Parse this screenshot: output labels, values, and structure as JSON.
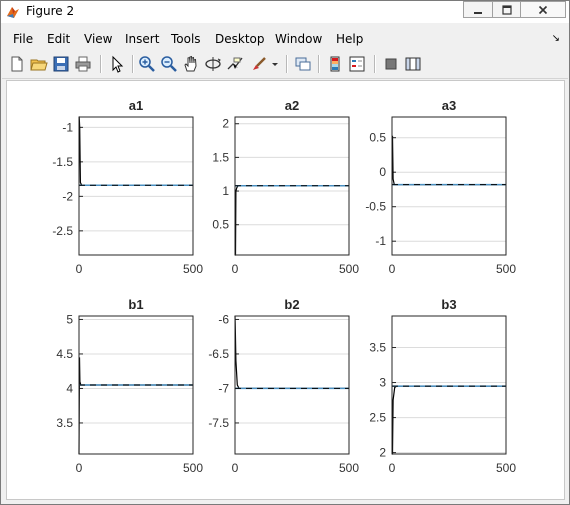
{
  "window": {
    "title": "Figure 2",
    "icon": "matlab-logo-icon",
    "controls": [
      "minimize-icon",
      "maximize-icon",
      "close-icon"
    ]
  },
  "menubar": {
    "items": [
      {
        "label": "File"
      },
      {
        "label": "Edit"
      },
      {
        "label": "View"
      },
      {
        "label": "Insert"
      },
      {
        "label": "Tools"
      },
      {
        "label": "Desktop"
      },
      {
        "label": "Window"
      },
      {
        "label": "Help"
      }
    ]
  },
  "toolbar": {
    "buttons": [
      "new-figure-icon",
      "open-file-icon",
      "save-icon",
      "print-icon",
      "edit-plot-icon",
      "zoom-in-icon",
      "zoom-out-icon",
      "pan-icon",
      "rotate-3d-icon",
      "data-cursor-icon",
      "brush-icon",
      "brush-dropdown-icon",
      "link-plot-icon",
      "insert-colorbar-icon",
      "insert-legend-icon",
      "hide-plot-tools-icon",
      "show-plot-tools-icon"
    ]
  },
  "colors": {
    "trace": "#000000",
    "reference": "#4a90c2",
    "grid": "#dcdcdc"
  },
  "chart_data": [
    {
      "type": "line",
      "title": "a1",
      "xlim": [
        0,
        500
      ],
      "ylim": [
        -2.85,
        -0.85
      ],
      "xticks": [
        0,
        500
      ],
      "yticks": [
        -1,
        -1.5,
        -2,
        -2.5
      ],
      "grid": "y",
      "series": [
        {
          "role": "estimate",
          "x": [
            0,
            1,
            3,
            6,
            12,
            500
          ],
          "y": [
            -0.85,
            -0.85,
            -1.0,
            -1.8,
            -1.84,
            -1.84
          ]
        },
        {
          "role": "true-value",
          "style": "dashed",
          "x": [
            0,
            500
          ],
          "y": [
            -1.84,
            -1.84
          ]
        }
      ]
    },
    {
      "type": "line",
      "title": "a2",
      "xlim": [
        0,
        500
      ],
      "ylim": [
        0.05,
        2.1
      ],
      "xticks": [
        0,
        500
      ],
      "yticks": [
        2,
        1.5,
        1,
        0.5
      ],
      "grid": "y",
      "series": [
        {
          "role": "estimate",
          "x": [
            0,
            2,
            4,
            8,
            14,
            500
          ],
          "y": [
            0.05,
            0.05,
            1.0,
            1.05,
            1.08,
            1.08
          ]
        },
        {
          "role": "true-value",
          "style": "dashed",
          "x": [
            0,
            500
          ],
          "y": [
            1.08,
            1.08
          ]
        }
      ]
    },
    {
      "type": "line",
      "title": "a3",
      "xlim": [
        0,
        500
      ],
      "ylim": [
        -1.2,
        0.8
      ],
      "xticks": [
        0,
        500
      ],
      "yticks": [
        0.5,
        0,
        -0.5,
        -1
      ],
      "grid": "y",
      "series": [
        {
          "role": "estimate",
          "x": [
            0,
            2,
            5,
            10,
            500
          ],
          "y": [
            0.52,
            0.52,
            -0.1,
            -0.18,
            -0.18
          ]
        },
        {
          "role": "true-value",
          "style": "dashed",
          "x": [
            0,
            500
          ],
          "y": [
            -0.18,
            -0.18
          ]
        }
      ]
    },
    {
      "type": "line",
      "title": "b1",
      "xlim": [
        0,
        500
      ],
      "ylim": [
        3.05,
        5.05
      ],
      "xticks": [
        0,
        500
      ],
      "yticks": [
        5,
        4.5,
        4,
        3.5
      ],
      "grid": "y",
      "series": [
        {
          "role": "estimate",
          "x": [
            0,
            2,
            4,
            8,
            500
          ],
          "y": [
            3.05,
            4.45,
            4.1,
            4.05,
            4.05
          ]
        },
        {
          "role": "true-value",
          "style": "dashed",
          "x": [
            0,
            500
          ],
          "y": [
            4.05,
            4.05
          ]
        }
      ]
    },
    {
      "type": "line",
      "title": "b2",
      "xlim": [
        0,
        500
      ],
      "ylim": [
        -7.95,
        -5.95
      ],
      "xticks": [
        0,
        500
      ],
      "yticks": [
        -6,
        -6.5,
        -7,
        -7.5
      ],
      "grid": "y",
      "series": [
        {
          "role": "estimate",
          "x": [
            0,
            1,
            4,
            10,
            18,
            500
          ],
          "y": [
            -5.95,
            -6.05,
            -6.6,
            -6.95,
            -7.0,
            -7.0
          ]
        },
        {
          "role": "true-value",
          "style": "dashed",
          "x": [
            0,
            500
          ],
          "y": [
            -7.0,
            -7.0
          ]
        }
      ]
    },
    {
      "type": "line",
      "title": "b3",
      "xlim": [
        0,
        500
      ],
      "ylim": [
        1.98,
        3.95
      ],
      "xticks": [
        0,
        500
      ],
      "yticks": [
        3.5,
        3,
        2.5,
        2
      ],
      "grid": "y",
      "series": [
        {
          "role": "estimate",
          "x": [
            0,
            2,
            5,
            12,
            20,
            500
          ],
          "y": [
            1.98,
            1.98,
            2.75,
            2.93,
            2.95,
            2.95
          ]
        },
        {
          "role": "true-value",
          "style": "dashed",
          "x": [
            0,
            500
          ],
          "y": [
            2.95,
            2.95
          ]
        }
      ]
    }
  ]
}
